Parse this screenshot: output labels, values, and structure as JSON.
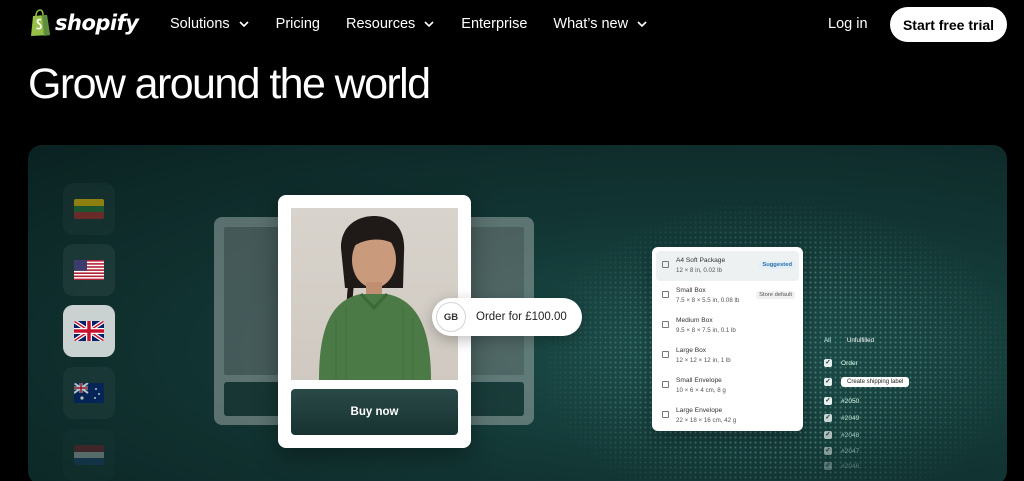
{
  "nav": {
    "brand": "shopify",
    "items": [
      {
        "label": "Solutions",
        "has_dropdown": true
      },
      {
        "label": "Pricing",
        "has_dropdown": false
      },
      {
        "label": "Resources",
        "has_dropdown": true
      },
      {
        "label": "Enterprise",
        "has_dropdown": false
      },
      {
        "label": "What’s new",
        "has_dropdown": true
      }
    ],
    "login": "Log in",
    "cta": "Start free trial"
  },
  "headline": "Grow around the world",
  "colors": {
    "brand_green": "#95bf47",
    "panel_dark": "#123634",
    "button_dark": "#1c3937"
  },
  "flags": [
    {
      "country": "Lithuania",
      "icon": "lithuania-flag-icon",
      "active": false
    },
    {
      "country": "United States",
      "icon": "us-flag-icon",
      "active": false
    },
    {
      "country": "United Kingdom",
      "icon": "uk-flag-icon",
      "active": true
    },
    {
      "country": "Australia",
      "icon": "australia-flag-icon",
      "active": false
    },
    {
      "country": "Netherlands",
      "icon": "netherlands-flag-icon",
      "active": false
    }
  ],
  "product_card": {
    "buy_label": "Buy now"
  },
  "order_pill": {
    "country_code": "GB",
    "text": "Order for £100.00"
  },
  "packages": [
    {
      "name": "A4 Soft Package",
      "dims": "12 × 8 in, 0.02 lb",
      "tag": "Suggested"
    },
    {
      "name": "Small Box",
      "dims": "7.5 × 8 × 5.5 in, 0.08 lb",
      "tag": "Store default"
    },
    {
      "name": "Medium Box",
      "dims": "9.5 × 8 × 7.5 in, 0.1 lb",
      "tag": ""
    },
    {
      "name": "Large Box",
      "dims": "12 × 12 × 12 in, 1 lb",
      "tag": ""
    },
    {
      "name": "Small Envelope",
      "dims": "10 × 6 × 4 cm, 8 g",
      "tag": ""
    },
    {
      "name": "Large Envelope",
      "dims": "22 × 18 × 16 cm, 42 g",
      "tag": ""
    }
  ],
  "orders": {
    "tabs": [
      "All",
      "Unfulfilled"
    ],
    "header": "Order",
    "ship_label": "Create shipping label",
    "rows": [
      "#2050",
      "#2049",
      "#2048",
      "#2047",
      "#2046"
    ]
  }
}
